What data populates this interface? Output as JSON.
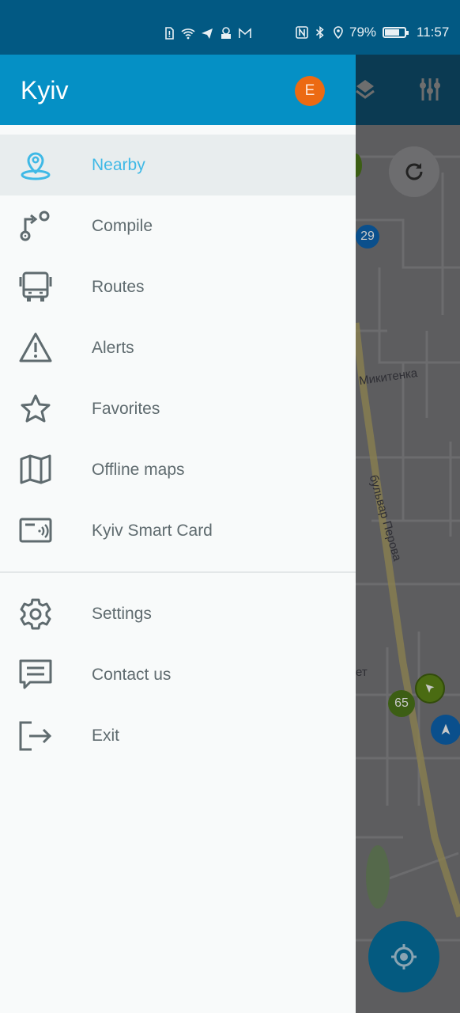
{
  "status_bar": {
    "left_icons": [
      "sim-alert-icon",
      "wifi-icon",
      "telegram-icon",
      "app-notification-icon",
      "gmail-icon"
    ],
    "right_icons": [
      "nfc-icon",
      "bluetooth-icon",
      "location-icon"
    ],
    "battery_percent": "79%",
    "battery_level": 0.79,
    "time": "11:57"
  },
  "drawer": {
    "title": "Kyiv",
    "avatar_initial": "E",
    "avatar_color": "#ec6a12",
    "header_color": "#0590c5",
    "primary_items": [
      {
        "label": "Nearby",
        "icon": "location-pin-icon",
        "active": true
      },
      {
        "label": "Compile",
        "icon": "route-compile-icon",
        "active": false
      },
      {
        "label": "Routes",
        "icon": "bus-icon",
        "active": false
      },
      {
        "label": "Alerts",
        "icon": "warning-icon",
        "active": false
      },
      {
        "label": "Favorites",
        "icon": "star-icon",
        "active": false
      },
      {
        "label": "Offline maps",
        "icon": "map-icon",
        "active": false
      },
      {
        "label": "Kyiv Smart Card",
        "icon": "smart-card-icon",
        "active": false
      }
    ],
    "secondary_items": [
      {
        "label": "Settings",
        "icon": "gear-icon"
      },
      {
        "label": "Contact us",
        "icon": "chat-icon"
      },
      {
        "label": "Exit",
        "icon": "exit-icon"
      }
    ],
    "active_color": "#3fb9e6"
  },
  "map": {
    "toolbar_icons": [
      "layers-icon",
      "filter-sliders-icon"
    ],
    "street_labels": [
      "Микитенка",
      "бульвар Перова",
      "ет"
    ],
    "markers": [
      {
        "label": "29",
        "type": "route-number",
        "color": "#0a4f8c"
      },
      {
        "label": "65",
        "type": "route-number",
        "color": "#3c5e14"
      },
      {
        "label": "",
        "type": "vehicle-direction",
        "color": "#4a6b12"
      },
      {
        "label": "",
        "type": "vehicle-direction",
        "color": "#0a4f8c"
      }
    ]
  }
}
